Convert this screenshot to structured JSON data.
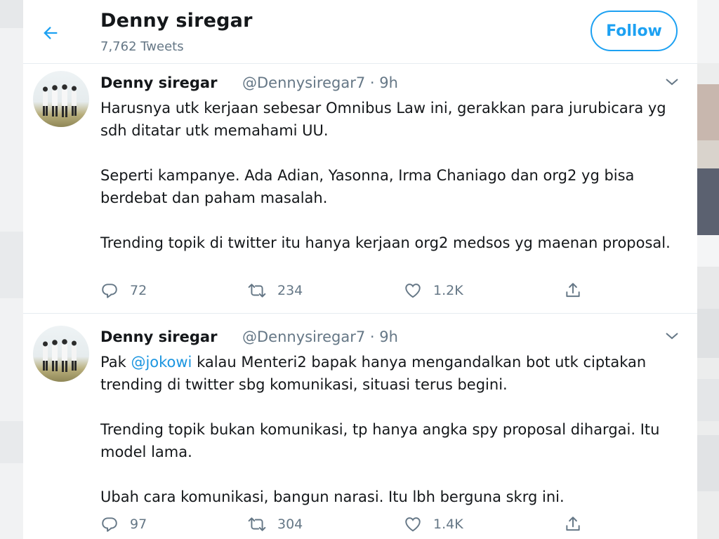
{
  "header": {
    "profile_name": "Denny siregar",
    "tweet_count": "7,762 Tweets",
    "follow_label": "Follow"
  },
  "tweets": [
    {
      "author": "Denny siregar",
      "handle_time": "@Dennysiregar7 · 9h",
      "paragraphs": [
        "Harusnya utk kerjaan sebesar Omnibus Law ini, gerakkan para jurubicara yg sdh ditatar utk memahami UU.",
        "Seperti kampanye. Ada Adian, Yasonna, Irma Chaniago dan org2 yg bisa berdebat dan paham masalah.",
        "Trending topik di twitter itu hanya kerjaan org2 medsos yg maenan proposal."
      ],
      "replies": "72",
      "retweets": "234",
      "likes": "1.2K"
    },
    {
      "author": "Denny siregar",
      "handle_time": "@Dennysiregar7 · 9h",
      "p1_prefix": "Pak ",
      "mention": "@jokowi",
      "p1_suffix": " kalau Menteri2 bapak hanya mengandalkan bot utk ciptakan trending di twitter sbg komunikasi, situasi terus begini.",
      "paragraphs": [
        "",
        "Trending topik bukan komunikasi, tp hanya angka spy proposal dihargai. Itu model lama.",
        "Ubah cara komunikasi, bangun narasi. Itu lbh berguna skrg ini."
      ],
      "replies": "97",
      "retweets": "304",
      "likes": "1.4K"
    }
  ],
  "icons": {
    "back": "arrow-left",
    "caret": "chevron-down",
    "reply": "speech-bubble",
    "retweet": "retweet-arrows",
    "like": "heart",
    "share": "share-upload"
  },
  "colors": {
    "accent": "#1da1f2",
    "secondary_text": "#657786",
    "mention": "#1b95e0"
  }
}
